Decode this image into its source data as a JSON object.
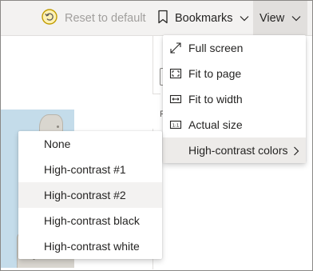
{
  "toolbar": {
    "reset_label": "Reset to default",
    "bookmarks_label": "Bookmarks",
    "view_label": "View"
  },
  "view_menu": {
    "items": [
      {
        "label": "Full screen",
        "icon": "full-screen-icon"
      },
      {
        "label": "Fit to page",
        "icon": "fit-to-page-icon"
      },
      {
        "label": "Fit to width",
        "icon": "fit-to-width-icon"
      },
      {
        "label": "Actual size",
        "icon": "actual-size-icon",
        "icon_text": "1:1"
      },
      {
        "label": "High-contrast colors",
        "icon": "chevron-right-icon"
      }
    ],
    "active_item": "High-contrast colors"
  },
  "contrast_menu": {
    "items": [
      {
        "label": "None"
      },
      {
        "label": "High-contrast #1"
      },
      {
        "label": "High-contrast #2"
      },
      {
        "label": "High-contrast black"
      },
      {
        "label": "High-contrast white"
      }
    ],
    "highlighted_item": "High-contrast #2"
  },
  "background": {
    "fragment_text": "F"
  },
  "colors": {
    "toolbar_bg": "#f3f2f1",
    "view_button_bg": "#e1dfdd",
    "reset_icon": "#c19c00",
    "disabled_text": "#a19f9d",
    "text": "#252423",
    "map_water": "#c4dcea"
  }
}
